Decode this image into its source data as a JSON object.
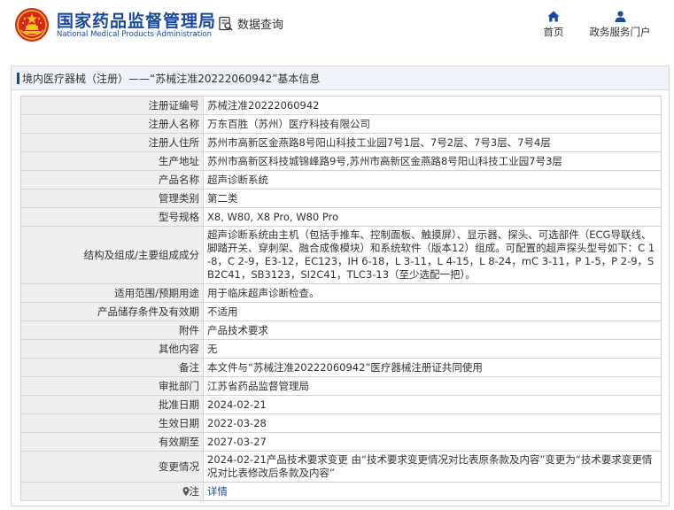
{
  "header": {
    "title_cn": "国家药品监督管理局",
    "title_en": "National Medical Products Administration",
    "query_label": "数据查询",
    "nav": [
      {
        "label": "首页",
        "icon": "home-icon"
      },
      {
        "label": "政务服务门户",
        "icon": "user-icon"
      }
    ]
  },
  "panel": {
    "title": "境内医疗器械（注册）——“苏械注准20222060942”基本信息"
  },
  "rows": [
    {
      "key": "注册证编号",
      "value": "苏械注准20222060942"
    },
    {
      "key": "注册人名称",
      "value": "万东百胜（苏州）医疗科技有限公司"
    },
    {
      "key": "注册人住所",
      "value": "苏州市高新区金燕路8号阳山科技工业园7号1层、7号2层、7号3层、7号4层"
    },
    {
      "key": "生产地址",
      "value": "苏州市高新区科技城锦峰路9号,苏州市高新区金燕路8号阳山科技工业园7号3层"
    },
    {
      "key": "产品名称",
      "value": "超声诊断系统"
    },
    {
      "key": "管理类别",
      "value": "第二类"
    },
    {
      "key": "型号规格",
      "value": "X8, W80, X8 Pro, W80 Pro"
    },
    {
      "key": "结构及组成/主要组成成分",
      "value": "超声诊断系统由主机（包括手推车、控制面板、触摸屏）、显示器、探头、可选部件（ECG导联线、脚踏开关、穿刺架、融合成像模块）和系统软件（版本12）组成。可配置的超声探头型号如下：C 1-8，C 2-9，E3-12，EC123，IH 6-18，L 3-11，L 4-15，L 8-24，mC 3-11，P 1-5，P 2-9，SB2C41，SB3123，SI2C41，TLC3-13（至少选配一把）。"
    },
    {
      "key": "适用范围/预期用途",
      "value": "用于临床超声诊断检查。"
    },
    {
      "key": "产品储存条件及有效期",
      "value": "不适用"
    },
    {
      "key": "附件",
      "value": "产品技术要求"
    },
    {
      "key": "其他内容",
      "value": "无"
    },
    {
      "key": "备注",
      "value": "本文件与“苏械注准20222060942”医疗器械注册证共同使用"
    },
    {
      "key": "审批部门",
      "value": "江苏省药品监督管理局"
    },
    {
      "key": "批准日期",
      "value": "2024-02-21"
    },
    {
      "key": "生效日期",
      "value": "2022-03-28"
    },
    {
      "key": "有效期至",
      "value": "2027-03-27"
    },
    {
      "key": "变更情况",
      "value": "2024-02-21产品技术要求变更 由“技术要求变更情况对比表原条款及内容”变更为“技术要求变更情况对比表修改后条款及内容”"
    }
  ],
  "note_row": {
    "key": "注",
    "value": "详情",
    "icon": "pin-icon"
  },
  "colors": {
    "brand": "#1a4aa0",
    "emblem_red": "#d7261e",
    "emblem_gold": "#f5c518",
    "label_bg": "#efefef"
  }
}
